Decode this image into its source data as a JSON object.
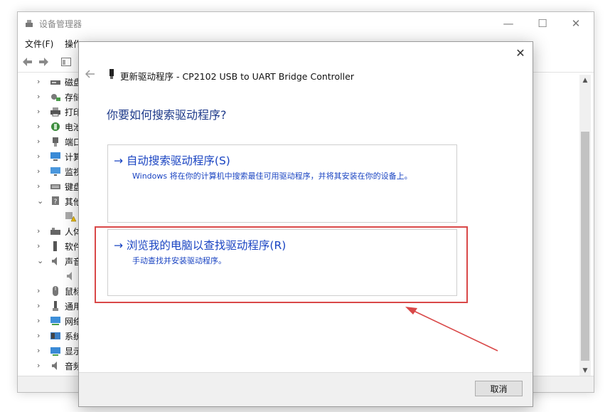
{
  "device_manager": {
    "title": "设备管理器",
    "menu": [
      "文件(F)",
      "操作"
    ],
    "tree_items": [
      {
        "label": "磁盘",
        "expanded": false
      },
      {
        "label": "存储",
        "expanded": false
      },
      {
        "label": "打印",
        "expanded": false
      },
      {
        "label": "电池",
        "expanded": false
      },
      {
        "label": "端口",
        "expanded": false
      },
      {
        "label": "计算",
        "expanded": false
      },
      {
        "label": "监视",
        "expanded": false
      },
      {
        "label": "键盘",
        "expanded": false
      },
      {
        "label": "其他",
        "expanded": true
      },
      {
        "label": "",
        "expanded": null
      },
      {
        "label": "人体",
        "expanded": false
      },
      {
        "label": "软件",
        "expanded": false
      },
      {
        "label": "声音",
        "expanded": true
      },
      {
        "label": "",
        "expanded": null
      },
      {
        "label": "鼠标",
        "expanded": false
      },
      {
        "label": "通用",
        "expanded": false
      },
      {
        "label": "网络",
        "expanded": false
      },
      {
        "label": "系统",
        "expanded": false
      },
      {
        "label": "显示",
        "expanded": false
      },
      {
        "label": "音频",
        "expanded": false
      }
    ]
  },
  "dialog": {
    "title": "更新驱动程序 - CP2102 USB to UART Bridge Controller",
    "question": "你要如何搜索驱动程序?",
    "options": [
      {
        "title": "→ 自动搜索驱动程序(S)",
        "description": "Windows 将在你的计算机中搜索最佳可用驱动程序，并将其安装在你的设备上。"
      },
      {
        "title": "→ 浏览我的电脑以查找驱动程序(R)",
        "description": "手动查找并安装驱动程序。"
      }
    ],
    "cancel_label": "取消"
  },
  "colors": {
    "link_blue": "#1a44c2",
    "heading_blue": "#1e3a8a",
    "annotation_red": "#d94848"
  }
}
